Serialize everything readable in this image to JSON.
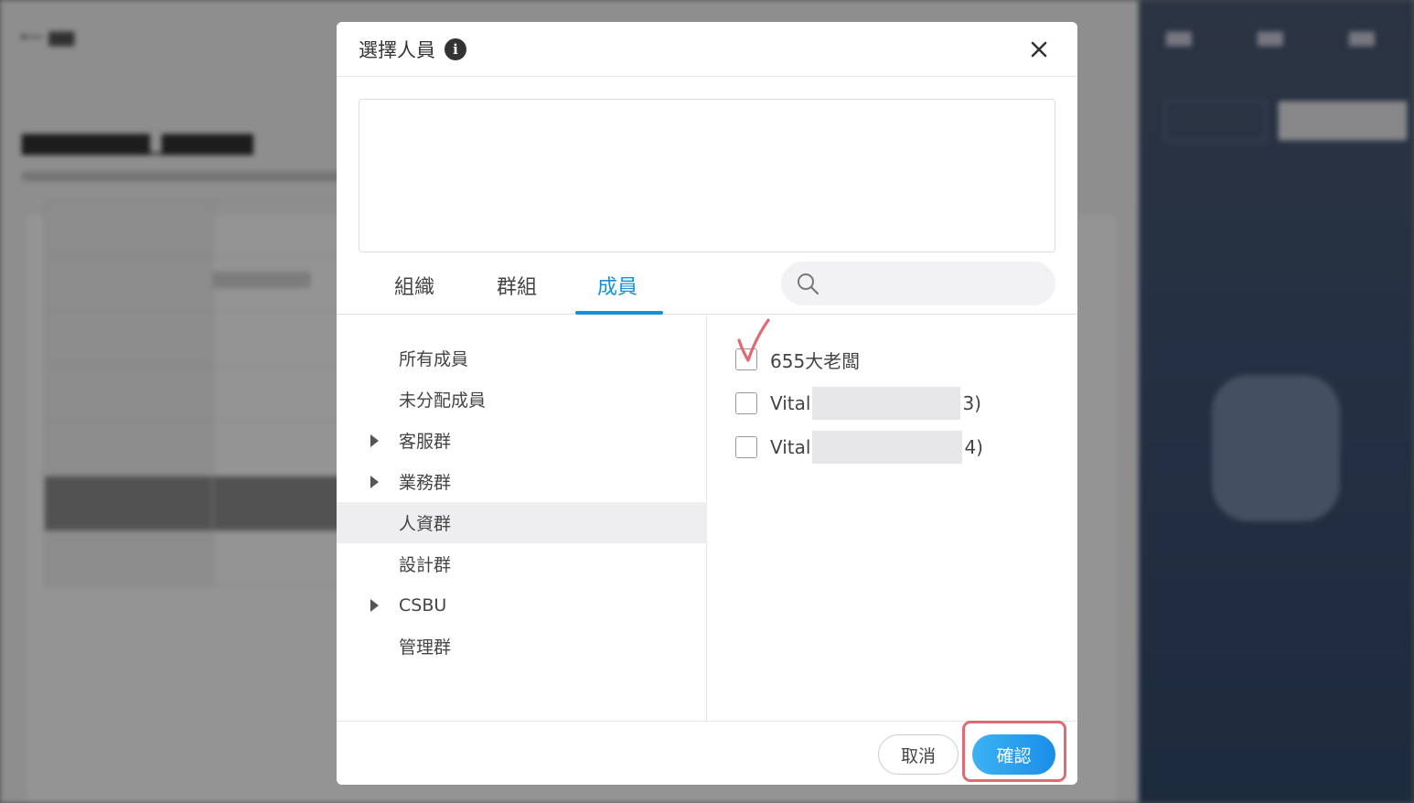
{
  "dialog": {
    "title": "選擇人員",
    "tabs": [
      {
        "label": "組織",
        "active": false
      },
      {
        "label": "群組",
        "active": false
      },
      {
        "label": "成員",
        "active": true
      }
    ],
    "search": {
      "placeholder": ""
    },
    "tree": [
      {
        "label": "所有成員",
        "expandable": false,
        "selected": false
      },
      {
        "label": "未分配成員",
        "expandable": false,
        "selected": false
      },
      {
        "label": "客服群",
        "expandable": true,
        "selected": false
      },
      {
        "label": "業務群",
        "expandable": true,
        "selected": false
      },
      {
        "label": "人資群",
        "expandable": false,
        "selected": true
      },
      {
        "label": "設計群",
        "expandable": false,
        "selected": false
      },
      {
        "label": "CSBU",
        "expandable": true,
        "selected": false
      },
      {
        "label": "管理群",
        "expandable": false,
        "selected": false
      }
    ],
    "members": [
      {
        "name_prefix": "655大老闆",
        "name_suffix": "",
        "checked": false,
        "redacted": false
      },
      {
        "name_prefix": "Vital",
        "name_suffix": "3)",
        "checked": false,
        "redacted": true
      },
      {
        "name_prefix": "Vital",
        "name_suffix": "4)",
        "checked": false,
        "redacted": true
      }
    ],
    "buttons": {
      "cancel": "取消",
      "confirm": "確認"
    }
  },
  "colors": {
    "accent": "#1890d8",
    "annotation": "#e06a72"
  }
}
